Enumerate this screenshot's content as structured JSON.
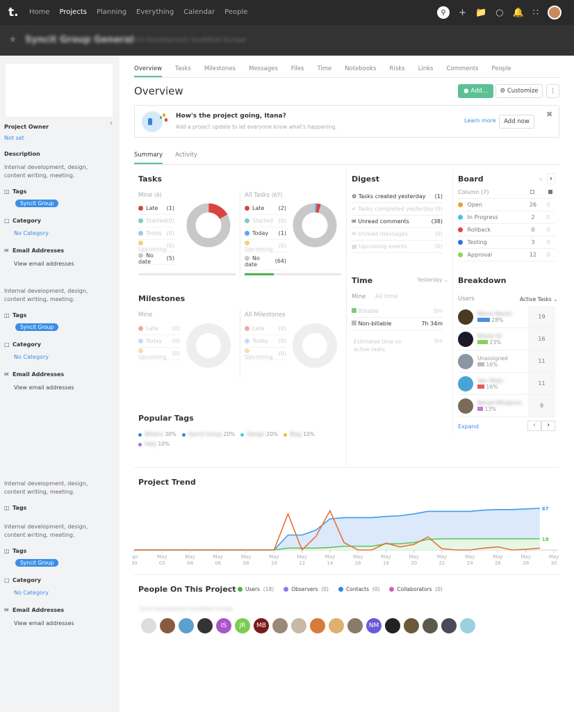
{
  "topnav": {
    "logo": "t.",
    "items": [
      "Home",
      "Projects",
      "Planning",
      "Everything",
      "Calendar",
      "People"
    ],
    "active": "Projects"
  },
  "project": {
    "name": "Syncit Group General",
    "company": "Syncit Development SouthEast Europe"
  },
  "sidebar": {
    "owner_label": "Project Owner",
    "owner_value": "Not set",
    "description_label": "Description",
    "sections": [
      {
        "description": "Internal development, design, content writing, meeting.",
        "tags_label": "Tags",
        "tag": "Syncit Group",
        "category_label": "Category",
        "category": "No Category",
        "email_label": "Email Addresses",
        "email_link": "View email addresses"
      },
      {
        "description": "Internal development, design, content writing, meeting.",
        "tags_label": "Tags",
        "tag": "Syncit Group",
        "category_label": "Category",
        "category": "No Category",
        "email_label": "Email Addresses",
        "email_link": "View email addresses"
      },
      {
        "description": "Internal development, design, content writing, meeting.",
        "tags_label": "Tags"
      },
      {
        "description": "Internal development, design, content writing, meeting.",
        "tags_label": "Tags",
        "tag": "Syncit Group",
        "category_label": "Category",
        "category": "No Category",
        "email_label": "Email Addresses",
        "email_link": "View email addresses"
      }
    ]
  },
  "tabs": [
    "Overview",
    "Tasks",
    "Milestones",
    "Messages",
    "Files",
    "Time",
    "Notebooks",
    "Risks",
    "Links",
    "Comments",
    "People"
  ],
  "overview": {
    "title": "Overview",
    "add": "Add...",
    "customize": "Customize"
  },
  "banner": {
    "title": "How's the project going, Itana?",
    "text": "Add a project update to let everyone know what's happening.",
    "learn_more": "Learn more",
    "add_now": "Add now"
  },
  "subtabs": [
    "Summary",
    "Activity"
  ],
  "tasks": {
    "title": "Tasks",
    "mine": {
      "label": "Mine",
      "count": "(6)",
      "rows": [
        {
          "label": "Late",
          "count": "(1)",
          "color": "#d9443f",
          "value": 1
        },
        {
          "label": "Started",
          "count": "(0)",
          "color": "#7fcdc0",
          "value": 0
        },
        {
          "label": "Today",
          "count": "(0)",
          "color": "#9cc8f5",
          "value": 0
        },
        {
          "label": "Upcoming",
          "count": "(0)",
          "color": "#f5cf7f",
          "value": 0
        },
        {
          "label": "No date",
          "count": "(5)",
          "color": "#c8c8c8",
          "value": 5
        }
      ],
      "progress": 0
    },
    "all": {
      "label": "All Tasks",
      "count": "(67)",
      "rows": [
        {
          "label": "Late",
          "count": "(2)",
          "color": "#d9443f",
          "value": 2
        },
        {
          "label": "Started",
          "count": "(0)",
          "color": "#7fcdc0",
          "value": 0
        },
        {
          "label": "Today",
          "count": "(1)",
          "color": "#5aa7f0",
          "value": 1
        },
        {
          "label": "Upcoming",
          "count": "(0)",
          "color": "#f5cf7f",
          "value": 0
        },
        {
          "label": "No date",
          "count": "(64)",
          "color": "#c8c8c8",
          "value": 64
        }
      ],
      "progress": 0.3
    }
  },
  "milestones": {
    "title": "Milestones",
    "mine_label": "Mine",
    "all_label": "All Milestones",
    "rows": [
      {
        "label": "Late",
        "count": "(0)",
        "color": "#f0a8a6"
      },
      {
        "label": "Today",
        "count": "(0)",
        "color": "#c4dcf5"
      },
      {
        "label": "Upcoming",
        "count": "(0)",
        "color": "#f8dfa8"
      }
    ]
  },
  "popular_tags": {
    "title": "Popular Tags",
    "items": [
      {
        "name": "Athena",
        "pct": "30%",
        "color": "#2f86e0"
      },
      {
        "name": "Syncit Group",
        "pct": "20%",
        "color": "#2f86e0"
      },
      {
        "name": "Design",
        "pct": "20%",
        "color": "#4fc9c9"
      },
      {
        "name": "Blog",
        "pct": "10%",
        "color": "#f5b731"
      },
      {
        "name": "Help",
        "pct": "10%",
        "color": "#9b6fdc"
      }
    ]
  },
  "digest": {
    "title": "Digest",
    "rows": [
      {
        "icon": "gear-icon",
        "label": "Tasks created yesterday",
        "count": "(1)",
        "active": true
      },
      {
        "icon": "check-circle-icon",
        "label": "Tasks completed yesterday",
        "count": "(0)",
        "active": false
      },
      {
        "icon": "comments-icon",
        "label": "Unread comments",
        "count": "(38)",
        "active": true
      },
      {
        "icon": "envelope-icon",
        "label": "Unread messages",
        "count": "(0)",
        "active": false
      },
      {
        "icon": "calendar-icon",
        "label": "Upcoming events",
        "count": "(0)",
        "active": false
      }
    ]
  },
  "time": {
    "title": "Time",
    "period": "Yesterday",
    "mine": "Mine",
    "all_time": "All time",
    "rows": [
      {
        "label": "Billable",
        "value": "0m",
        "color": "#4bb34b",
        "active": false
      },
      {
        "label": "Non-billable",
        "value": "7h 34m",
        "color": "#bbb",
        "active": true
      }
    ],
    "estimated_label": "Estimated time on active tasks",
    "estimated_value": "0m"
  },
  "board": {
    "title": "Board",
    "column_label": "Column (7)",
    "rows": [
      {
        "label": "Open",
        "color": "#f39c33",
        "open": "26",
        "done": "0"
      },
      {
        "label": "In Progress",
        "color": "#3cc4f0",
        "open": "2",
        "done": "0"
      },
      {
        "label": "Rollback",
        "color": "#e8403a",
        "open": "0",
        "done": "0"
      },
      {
        "label": "Testing",
        "color": "#2f6fe0",
        "open": "3",
        "done": "0"
      },
      {
        "label": "Approval",
        "color": "#7ed957",
        "open": "12",
        "done": "0"
      }
    ]
  },
  "breakdown": {
    "title": "Breakdown",
    "users_label": "Users",
    "sort": "Active Tasks",
    "expand": "Expand",
    "rows": [
      {
        "name": "Nikola Nikolić",
        "pct": "28%",
        "color": "#4a90e2",
        "count": "19",
        "avatar": "#4a3a20",
        "fill": 0.28
      },
      {
        "name": "Nikola Ilić",
        "pct": "23%",
        "color": "#8bd05a",
        "count": "16",
        "avatar": "#1a1a2a",
        "fill": 0.23
      },
      {
        "name": "Unassigned",
        "pct": "16%",
        "color": "#bbb",
        "count": "11",
        "avatar": "#8a96a3",
        "fill": 0.16
      },
      {
        "name": "Igor Stajic",
        "pct": "16%",
        "color": "#e85a5a",
        "count": "11",
        "avatar": "#4aa3d8",
        "fill": 0.16
      },
      {
        "name": "Nenad Mihajlović",
        "pct": "13%",
        "color": "#c27be0",
        "count": "9",
        "avatar": "#7a6a5a",
        "fill": 0.13
      }
    ]
  },
  "chart_data": {
    "type": "area",
    "title": "Project Trend",
    "x": [
      "Apr 30",
      "May 01",
      "May 02",
      "May 03",
      "May 04",
      "May 05",
      "May 06",
      "May 07",
      "May 08",
      "May 09",
      "May 10",
      "May 11",
      "May 12",
      "May 13",
      "May 14",
      "May 15",
      "May 16",
      "May 17",
      "May 18",
      "May 19",
      "May 20",
      "May 21",
      "May 22",
      "May 23",
      "May 24",
      "May 25",
      "May 26",
      "May 27",
      "May 28",
      "May 29"
    ],
    "xticks": [
      [
        "Apr",
        "30"
      ],
      [
        "May",
        "02"
      ],
      [
        "May",
        "04"
      ],
      [
        "May",
        "06"
      ],
      [
        "May",
        "08"
      ],
      [
        "May",
        "10"
      ],
      [
        "May",
        "12"
      ],
      [
        "May",
        "14"
      ],
      [
        "May",
        "16"
      ],
      [
        "May",
        "18"
      ],
      [
        "May",
        "20"
      ],
      [
        "May",
        "22"
      ],
      [
        "May",
        "24"
      ],
      [
        "May",
        "26"
      ],
      [
        "May",
        "28"
      ],
      [
        "May",
        "30"
      ]
    ],
    "series": [
      {
        "color": "#3d9bef",
        "fill": "#dbe9fb",
        "end_label": "67",
        "values": [
          0,
          0,
          0,
          0,
          0,
          0,
          0,
          0,
          0,
          0,
          0,
          24,
          24,
          32,
          50,
          52,
          52,
          52,
          54,
          55,
          58,
          62,
          62,
          62,
          62,
          64,
          65,
          65,
          66,
          67
        ]
      },
      {
        "color": "#5cc35c",
        "fill": "#e6f7e6",
        "end_label": "18",
        "values": [
          0,
          0,
          0,
          0,
          0,
          0,
          0,
          0,
          0,
          0,
          0,
          3,
          3,
          3,
          4,
          6,
          6,
          6,
          10,
          10,
          12,
          17,
          18,
          18,
          18,
          18,
          18,
          18,
          18,
          18
        ]
      },
      {
        "color": "#e8703a",
        "values": [
          0,
          0,
          0,
          0,
          0,
          0,
          0,
          0,
          0,
          0,
          0,
          58,
          0,
          22,
          63,
          12,
          0,
          0,
          11,
          5,
          9,
          21,
          2,
          0,
          0,
          3,
          5,
          0,
          1,
          3
        ]
      }
    ],
    "ylim": [
      0,
      67
    ],
    "grid": false
  },
  "people": {
    "title": "People On This Project",
    "legend": [
      {
        "label": "Users",
        "count": "(18)",
        "color": "#4bb34b"
      },
      {
        "label": "Observers",
        "count": "(0)",
        "color": "#8b7cf0"
      },
      {
        "label": "Contacts",
        "count": "(0)",
        "color": "#2f86e0"
      },
      {
        "label": "Collaborators",
        "count": "(0)",
        "color": "#d65bc0"
      }
    ],
    "company": "Syncit Development SouthEast Europe",
    "avatars": [
      {
        "i": "",
        "c": "#ddd"
      },
      {
        "i": "",
        "c": "#8a5a40"
      },
      {
        "i": "",
        "c": "#5aa0d0"
      },
      {
        "i": "",
        "c": "#333"
      },
      {
        "i": "IS",
        "c": "#a855c8"
      },
      {
        "i": "JR",
        "c": "#7ccc52"
      },
      {
        "i": "MB",
        "c": "#7a1a1a"
      },
      {
        "i": "",
        "c": "#9a8878"
      },
      {
        "i": "",
        "c": "#c8b8a8"
      },
      {
        "i": "",
        "c": "#d87a3a"
      },
      {
        "i": "",
        "c": "#e0b070"
      },
      {
        "i": "",
        "c": "#8a7a6a"
      },
      {
        "i": "NM",
        "c": "#6a5ad8"
      },
      {
        "i": "",
        "c": "#222"
      },
      {
        "i": "",
        "c": "#6a5a3a"
      },
      {
        "i": "",
        "c": "#5a5a4a"
      },
      {
        "i": "",
        "c": "#4a4a5a"
      },
      {
        "i": "",
        "c": "#9ad0e0"
      }
    ]
  }
}
